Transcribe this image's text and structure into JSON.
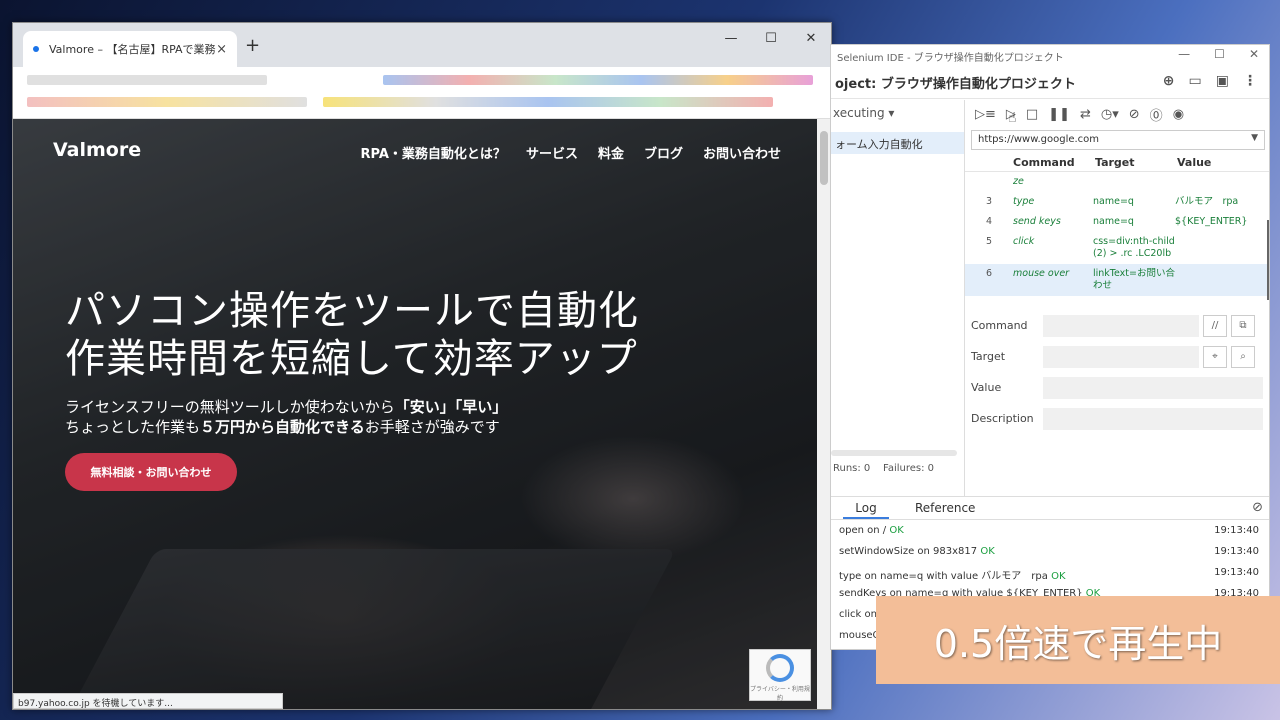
{
  "browser": {
    "tab_title": "Valmore – 【名古屋】RPAで業務改",
    "tab_close": "×",
    "new_tab": "+",
    "win_min": "—",
    "win_max": "☐",
    "win_close": "✕",
    "status_text": "b97.yahoo.co.jp を待機しています...",
    "site": {
      "brand": "Valmore",
      "nav": [
        "RPA・業務自動化とは？",
        "サービス",
        "料金",
        "ブログ",
        "お問い合わせ"
      ],
      "hero_line1": "パソコン操作をツールで自動化",
      "hero_line2": "作業時間を短縮して効率アップ",
      "sub_line1_a": "ライセンスフリーの無料ツールしか使わないから",
      "sub_line1_b": "「安い」「早い」",
      "sub_line2_a": "ちょっとした作業も",
      "sub_line2_b": "５万円から自動化できる",
      "sub_line2_c": "お手軽さが強みです",
      "cta": "無料相談・お問い合わせ",
      "recaptcha": "プライバシー・利用規約"
    }
  },
  "ide": {
    "window_title": "Selenium IDE - ブラウザ操作自動化プロジェクト",
    "project": "oject: ブラウザ操作自動化プロジェクト",
    "executing": "xecuting",
    "test_name": "ォーム入力自動化",
    "runs": "Runs: 0",
    "failures": "Failures: 0",
    "url": "https://www.google.com",
    "headers": {
      "command": "Command",
      "target": "Target",
      "value": "Value"
    },
    "partial_row": "ze",
    "rows": [
      {
        "n": "3",
        "command": "type",
        "target": "name=q",
        "value": "バルモア　rpa"
      },
      {
        "n": "4",
        "command": "send keys",
        "target": "name=q",
        "value": "${KEY_ENTER}"
      },
      {
        "n": "5",
        "command": "click",
        "target": "css=div:nth-child(2) > .rc .LC20lb",
        "value": ""
      },
      {
        "n": "6",
        "command": "mouse over",
        "target": "linkText=お問い合わせ",
        "value": ""
      }
    ],
    "form": {
      "command": "Command",
      "target": "Target",
      "value": "Value",
      "description": "Description"
    },
    "log_tab": "Log",
    "reference_tab": "Reference",
    "log": [
      {
        "text": "open on /",
        "status": "OK",
        "time": "19:13:40"
      },
      {
        "text": "setWindowSize on 983x817",
        "status": "OK",
        "time": "19:13:40"
      },
      {
        "text": "type on name=q with value バルモア　rpa",
        "status": "OK",
        "time": "19:13:40"
      },
      {
        "text": "sendKeys on name=q with value ${KEY_ENTER}",
        "status": "OK",
        "time": "19:13:40"
      },
      {
        "text": "click on",
        "status": "",
        "time": ""
      },
      {
        "text": "mouseO",
        "status": "",
        "time": ""
      }
    ]
  },
  "overlay_caption": "0.5倍速で再生中",
  "colors": {
    "cta": "#c8354a",
    "ok": "#1a9e3f",
    "overlay": "#f3be98",
    "accent": "#3b7ddd"
  }
}
